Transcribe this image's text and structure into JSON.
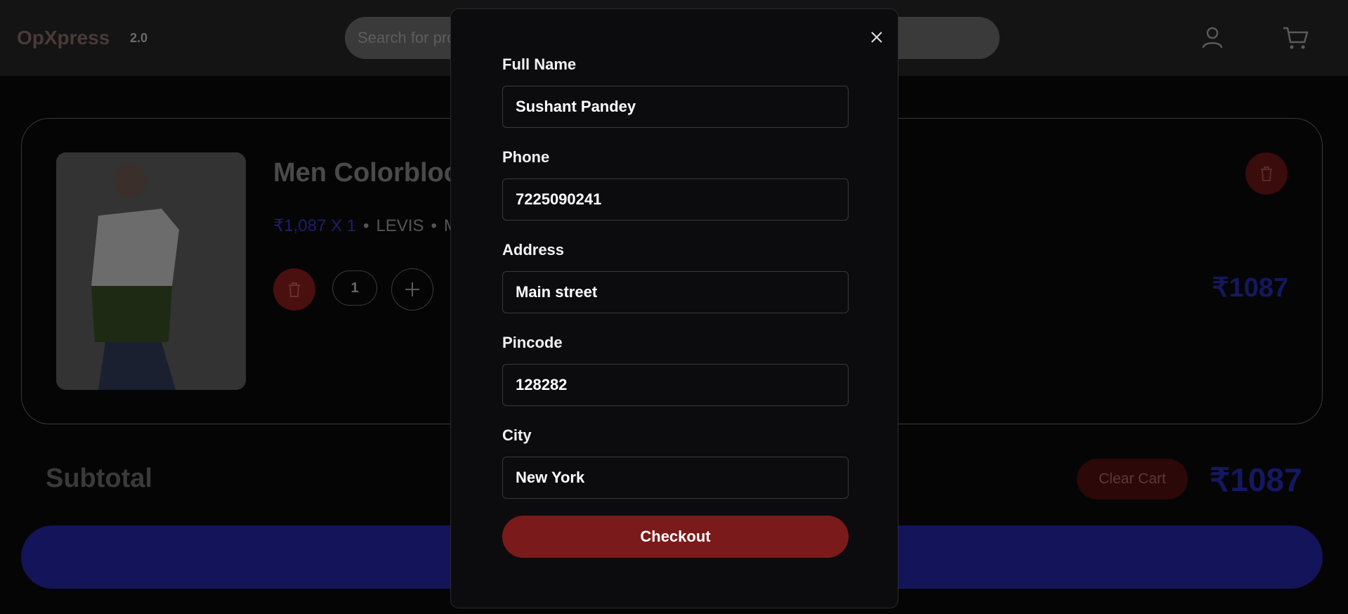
{
  "header": {
    "logo": "OpXpress",
    "version": "2.0",
    "search_placeholder": "Search for products"
  },
  "cart": {
    "item": {
      "title": "Men Colorblock",
      "price_qty": "₹1,087 X 1",
      "brand": "LEVIS",
      "size": "M",
      "quantity": "1",
      "line_total": "₹1087"
    },
    "subtotal_label": "Subtotal",
    "clear_cart_label": "Clear Cart",
    "subtotal_value": "₹1087"
  },
  "checkout_modal": {
    "fields": [
      {
        "label": "Full Name",
        "value": "Sushant Pandey"
      },
      {
        "label": "Phone",
        "value": "7225090241"
      },
      {
        "label": "Address",
        "value": "Main street"
      },
      {
        "label": "Pincode",
        "value": "128282"
      },
      {
        "label": "City",
        "value": "New York"
      }
    ],
    "checkout_label": "Checkout"
  },
  "colors": {
    "accent_red": "#7b1a1a",
    "accent_blue": "#14145a",
    "modal_bg": "#0c0c0e"
  }
}
